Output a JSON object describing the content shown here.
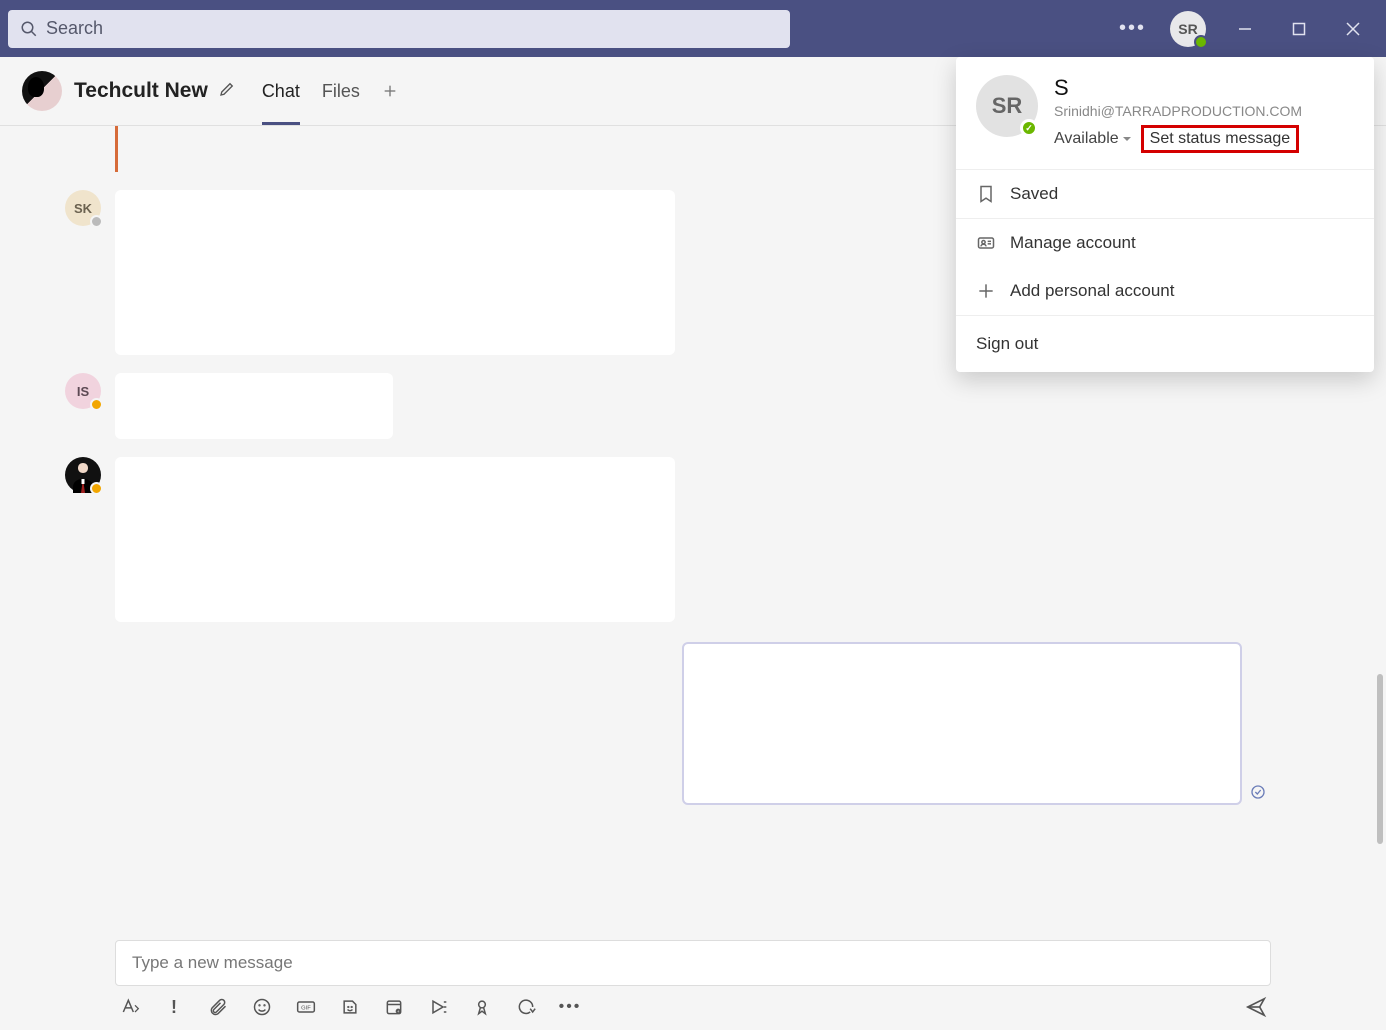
{
  "titlebar": {
    "search_placeholder": "Search",
    "avatar_initials": "SR"
  },
  "conversation": {
    "title": "Techcult New",
    "tabs": [
      {
        "label": "Chat",
        "active": true
      },
      {
        "label": "Files",
        "active": false
      }
    ]
  },
  "messages": {
    "sk_initials": "SK",
    "is_initials": "IS"
  },
  "compose": {
    "placeholder": "Type a new message"
  },
  "profile_menu": {
    "avatar_initials": "SR",
    "name": "S",
    "email": "Srinidhi@TARRADPRODUCTION.COM",
    "availability": "Available",
    "set_status": "Set status message",
    "saved": "Saved",
    "manage": "Manage account",
    "add_personal": "Add personal account",
    "signout": "Sign out"
  }
}
